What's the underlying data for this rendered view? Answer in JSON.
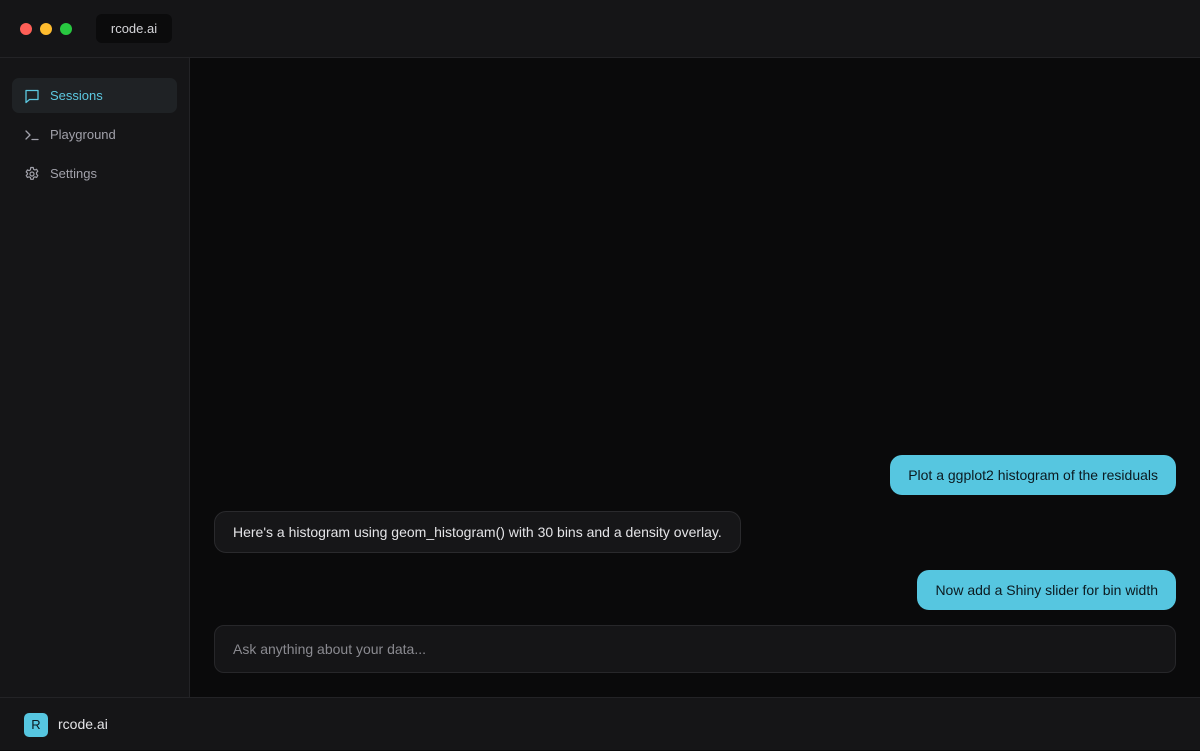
{
  "window": {
    "controls": [
      "close",
      "minimize",
      "maximize"
    ],
    "tab_title": "rcode.ai"
  },
  "sidebar": {
    "items": [
      {
        "label": "Sessions",
        "icon": "chat-bubble-icon",
        "active": true
      },
      {
        "label": "Playground",
        "icon": "terminal-icon",
        "active": false
      },
      {
        "label": "Settings",
        "icon": "gear-icon",
        "active": false
      }
    ]
  },
  "chat": {
    "messages": [
      {
        "role": "user",
        "text": "Plot a ggplot2 histogram of the residuals"
      },
      {
        "role": "assistant",
        "text": "Here's a histogram using geom_histogram() with 30 bins and a density overlay."
      },
      {
        "role": "user",
        "text": "Now add a Shiny slider for bin width"
      }
    ],
    "input": {
      "value": "",
      "placeholder": "Ask anything about your data..."
    }
  },
  "footer": {
    "logo_letter": "R",
    "app_name": "rcode.ai"
  },
  "colors": {
    "accent": "#56c6e0",
    "background": "#0a0a0b",
    "panel": "#151517"
  }
}
